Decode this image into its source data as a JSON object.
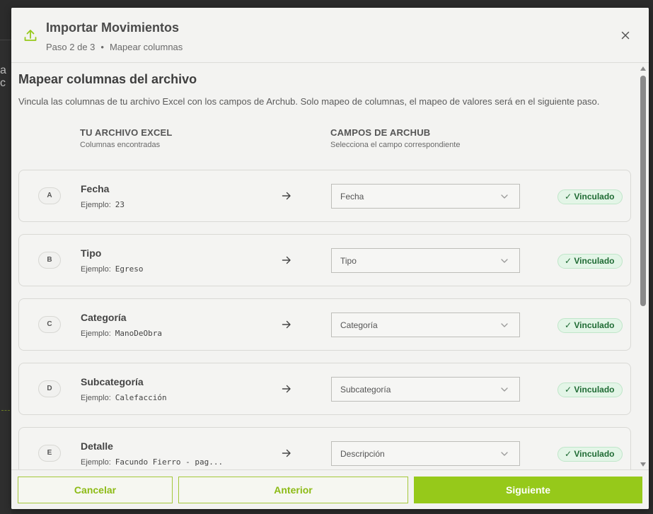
{
  "backdrop": {
    "bleed_text": "a c"
  },
  "header": {
    "title": "Importar Movimientos",
    "step": "Paso 2 de 3",
    "separator": "•",
    "step_name": "Mapear columnas",
    "icons": {
      "upload": "upload-icon",
      "close": "close-icon"
    }
  },
  "main": {
    "title": "Mapear columnas del archivo",
    "description": "Vincula las columnas de tu archivo Excel con los campos de Archub. Solo mapeo de columnas, el mapeo de valores será en el siguiente paso.",
    "left_header": {
      "title": "TU ARCHIVO EXCEL",
      "subtitle": "Columnas encontradas"
    },
    "right_header": {
      "title": "CAMPOS DE ARCHUB",
      "subtitle": "Selecciona el campo correspondiente"
    },
    "example_label": "Ejemplo:",
    "rows": [
      {
        "letter": "A",
        "column": "Fecha",
        "example": "23",
        "field": "Fecha",
        "status": "✓ Vinculado"
      },
      {
        "letter": "B",
        "column": "Tipo",
        "example": "Egreso",
        "field": "Tipo",
        "status": "✓ Vinculado"
      },
      {
        "letter": "C",
        "column": "Categoría",
        "example": "ManoDeObra",
        "field": "Categoría",
        "status": "✓ Vinculado"
      },
      {
        "letter": "D",
        "column": "Subcategoría",
        "example": "Calefacción",
        "field": "Subcategoría",
        "status": "✓ Vinculado"
      },
      {
        "letter": "E",
        "column": "Detalle",
        "example": "Facundo Fierro - pag...",
        "field": "Descripción",
        "status": "✓ Vinculado"
      }
    ]
  },
  "footer": {
    "cancel": "Cancelar",
    "previous": "Anterior",
    "next": "Siguiente"
  },
  "colors": {
    "accent": "#96c91a",
    "accent_text": "#8dbb16",
    "badge_bg": "#e3f5e7",
    "badge_text": "#1f6b34"
  }
}
